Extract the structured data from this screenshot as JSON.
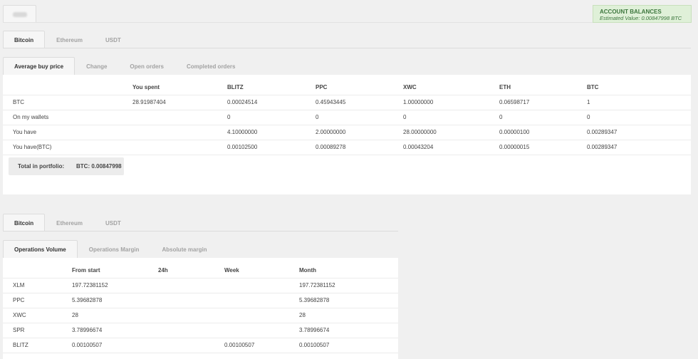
{
  "balance": {
    "title": "ACCOUNT BALANCES",
    "estimated": "Estimated Value: 0.00847998 BTC",
    "bg": "#dff0d8",
    "fg": "#3c763d"
  },
  "currency_tabs": [
    "Bitcoin",
    "Ethereum",
    "USDT"
  ],
  "top_panel": {
    "tabs": [
      "Average buy price",
      "Change",
      "Open orders",
      "Completed orders"
    ],
    "headers": [
      "",
      "You spent",
      "BLITZ",
      "PPC",
      "XWC",
      "ETH",
      "BTC"
    ],
    "rows": [
      [
        "BTC",
        "28.91987404",
        "0.00024514",
        "0.45943445",
        "1.00000000",
        "0.06598717",
        "1"
      ],
      [
        "On my wallets",
        "",
        "0",
        "0",
        "0",
        "0",
        "0"
      ],
      [
        "You have",
        "",
        "4.10000000",
        "2.00000000",
        "28.00000000",
        "0.00000100",
        "0.00289347"
      ],
      [
        "You have(BTC)",
        "",
        "0.00102500",
        "0.00089278",
        "0.00043204",
        "0.00000015",
        "0.00289347"
      ]
    ],
    "total_label": "Total in portfolio:",
    "total_value": "BTC: 0.00847998"
  },
  "bottom_panel": {
    "tabs": [
      "Operations Volume",
      "Operations Margin",
      "Absolute margin"
    ],
    "headers": [
      "",
      "From start",
      "24h",
      "Week",
      "Month"
    ],
    "rows": [
      [
        "XLM",
        "197.72381152",
        "",
        "",
        "197.72381152"
      ],
      [
        "PPC",
        "5.39682878",
        "",
        "",
        "5.39682878"
      ],
      [
        "XWC",
        "28",
        "",
        "",
        "28"
      ],
      [
        "SPR",
        "3.78996674",
        "",
        "",
        "3.78996674"
      ],
      [
        "BLITZ",
        "0.00100507",
        "",
        "0.00100507",
        "0.00100507"
      ]
    ]
  }
}
